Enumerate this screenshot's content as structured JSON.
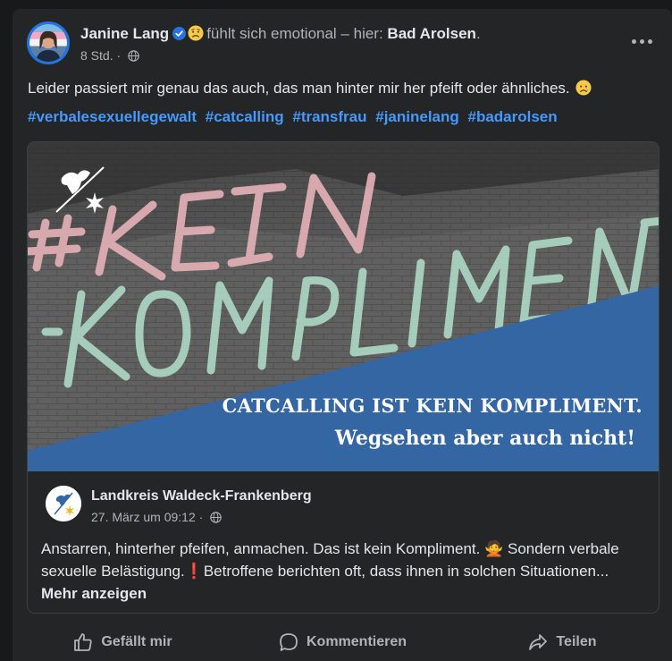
{
  "post": {
    "author": "Janine Lang",
    "feeling_text": "fühlt sich emotional – hier:",
    "location": "Bad Arolsen",
    "location_suffix": ".",
    "time": "8 Std.",
    "separator": "·",
    "text": "Leider passiert mir genau das auch, das man hinter mir her pfeift oder ähnliches.",
    "hashtags": [
      "#verbalesexuellegewalt",
      "#catcalling",
      "#transfrau",
      "#janinelang",
      "#badarolsen"
    ]
  },
  "image": {
    "chalk_line1": "#KEIN",
    "chalk_line2": "-KOMPLIMENT",
    "banner_line1": "CATCALLING IST KEIN KOMPLIMENT.",
    "banner_line2": "Wegsehen aber auch nicht!"
  },
  "shared": {
    "page_name": "Landkreis Waldeck-Frankenberg",
    "date": "27. März um 09:12",
    "separator": "·",
    "text_part1": "Anstarren, hinterher pfeifen, anmachen. Das ist kein Kompliment.",
    "emoji_woman": "🙅",
    "text_part2": "Sondern verbale sexuelle Belästigung.",
    "text_mark": "❗",
    "text_part3": "Betroffene berichten oft, dass ihnen in solchen Situationen...",
    "more_link": "Mehr anzeigen"
  },
  "actions": {
    "like": "Gefällt mir",
    "comment": "Kommentieren",
    "share": "Teilen"
  },
  "colors": {
    "background": "#18191a",
    "card": "#242526",
    "text": "#e4e6eb",
    "secondary": "#b0b3b8",
    "hashtag": "#4599ff",
    "banner_blue": "#3366a3",
    "verified": "#2374e1"
  },
  "icons": {
    "verified": "verified-badge-icon",
    "feeling": "sad-face-icon",
    "audience": "globe-icon",
    "menu": "more-options-icon",
    "like": "thumbs-up-icon",
    "comment": "comment-bubble-icon",
    "share": "share-arrow-icon"
  }
}
